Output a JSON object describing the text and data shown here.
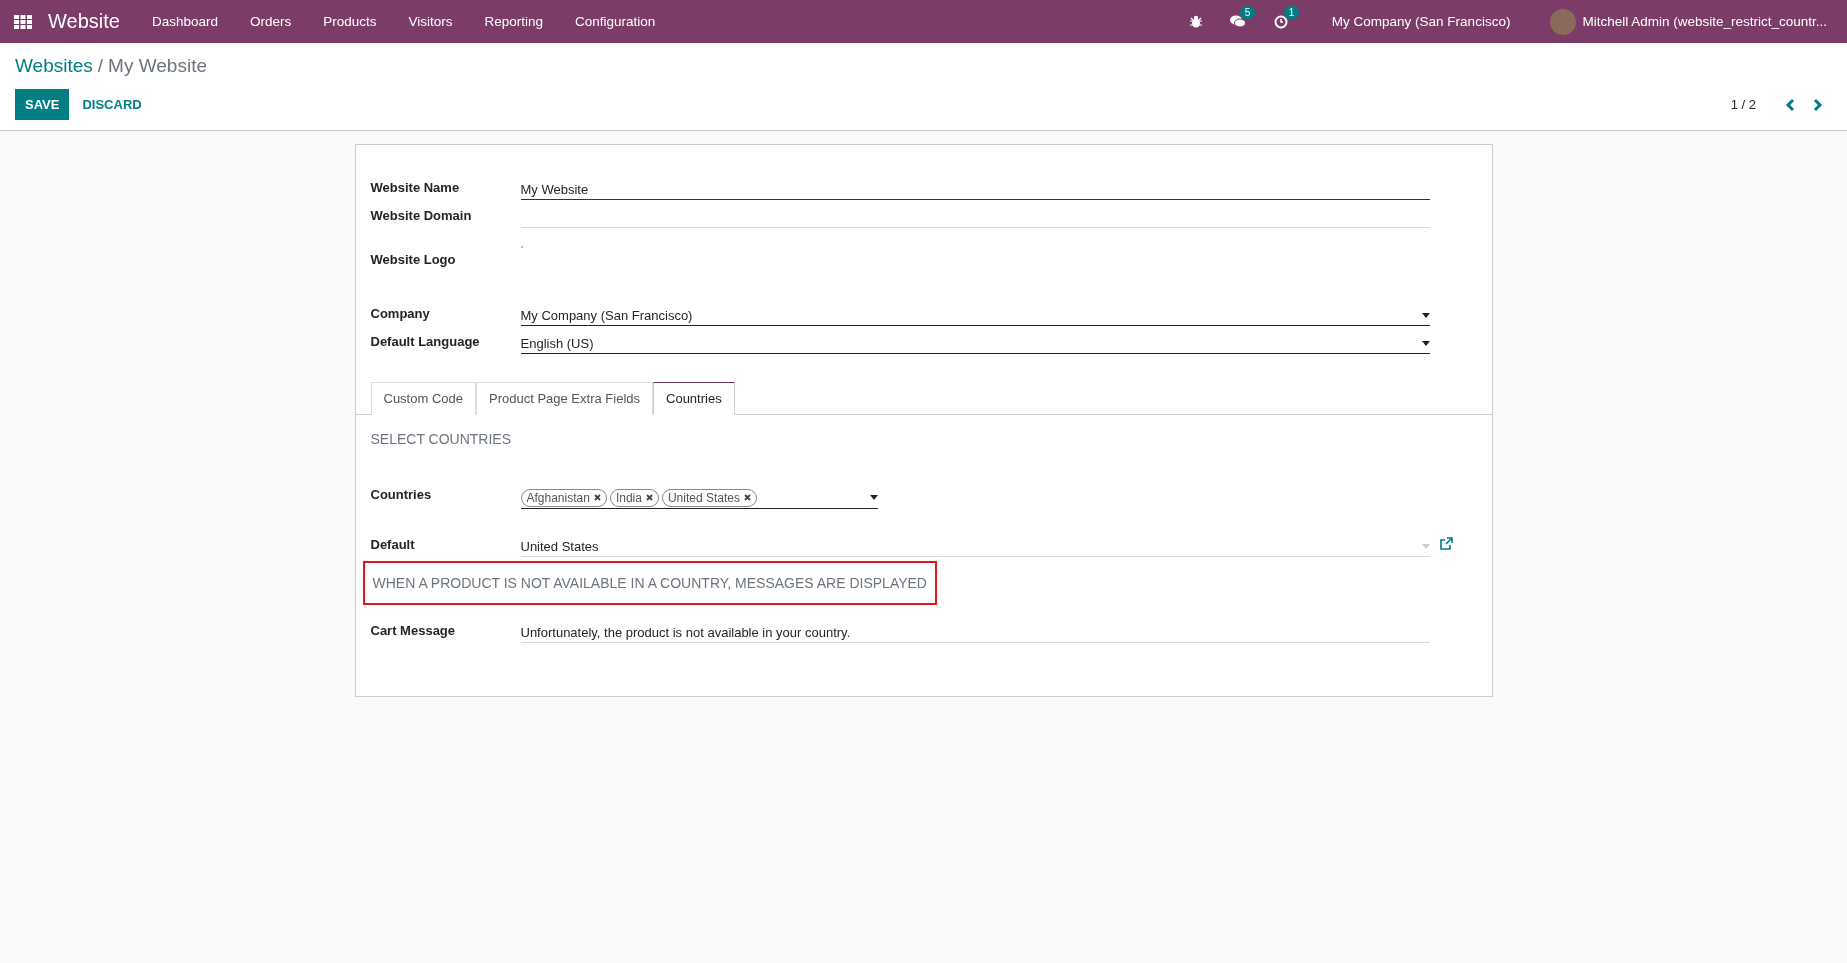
{
  "navbar": {
    "app_name": "Website",
    "menu": [
      "Dashboard",
      "Orders",
      "Products",
      "Visitors",
      "Reporting",
      "Configuration"
    ],
    "messages_count": "5",
    "activities_count": "1",
    "company": "My Company (San Francisco)",
    "user": "Mitchell Admin (website_restrict_countr..."
  },
  "breadcrumb": {
    "parent": "Websites",
    "separator": "/",
    "current": "My Website"
  },
  "buttons": {
    "save": "SAVE",
    "discard": "DISCARD"
  },
  "pager": "1 / 2",
  "fields": [
    {
      "label": "Website Name",
      "kind": "text",
      "value": "My Website"
    },
    {
      "label": "Website Domain",
      "kind": "text"
    },
    {
      "label": "Website Logo",
      "kind": "image"
    },
    {
      "label": "Company",
      "kind": "select",
      "value": "My Company (San Francisco)"
    },
    {
      "label": "Default Language",
      "kind": "select",
      "value": "English (US)"
    }
  ],
  "tabs": [
    {
      "label": "Custom Code",
      "selected": false
    },
    {
      "label": "Product Page Extra Fields",
      "selected": false
    },
    {
      "label": "Countries",
      "selected": true
    }
  ],
  "section_title": "SELECT COUNTRIES",
  "countries": {
    "label": "Countries",
    "tags": [
      "Afghanistan",
      "India",
      "United States"
    ]
  },
  "default": {
    "label": "Default",
    "value": "United States"
  },
  "message_section": {
    "title": "WHEN A PRODUCT IS NOT AVAILABLE IN A COUNTRY, MESSAGES ARE DISPLAYED",
    "highlighted": true
  },
  "cart_message": {
    "label": "Cart Message",
    "value": "Unfortunately, the product is not available in your country."
  }
}
